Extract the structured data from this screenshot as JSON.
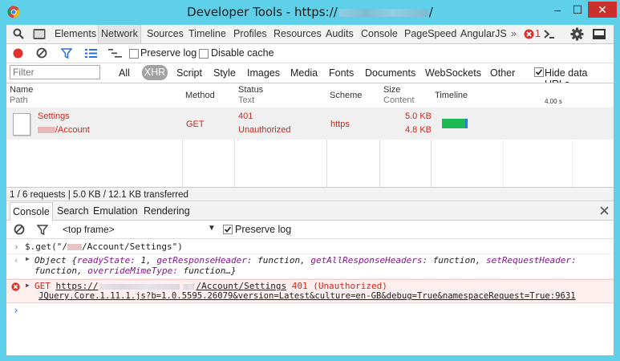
{
  "window": {
    "title_prefix": "Developer Tools - https://",
    "title_suffix": "/",
    "min": "–",
    "max": "☐",
    "close": "✕"
  },
  "panel_tabs": [
    "Elements",
    "Network",
    "Sources",
    "Timeline",
    "Profiles",
    "Resources",
    "Audits",
    "Console",
    "PageSpeed",
    "AngularJS"
  ],
  "panel_more": "»",
  "error_count": "1",
  "toolbar": {
    "preserve_log": "Preserve log",
    "disable_cache": "Disable cache"
  },
  "filter": {
    "placeholder": "Filter"
  },
  "types": [
    "All",
    "XHR",
    "Script",
    "Style",
    "Images",
    "Media",
    "Fonts",
    "Documents",
    "WebSockets",
    "Other"
  ],
  "hide_data_urls": "Hide data URLs",
  "columns": {
    "name": "Name",
    "path": "Path",
    "method": "Method",
    "status": "Status",
    "text": "Text",
    "scheme": "Scheme",
    "size": "Size",
    "content": "Content",
    "timeline": "Timeline",
    "tick": "4.00 s"
  },
  "request": {
    "name": "Settings",
    "path": "/Account",
    "method": "GET",
    "status": "401",
    "status_text": "Unauthorized",
    "scheme": "https",
    "size": "5.0 KB",
    "content": "4.8 KB"
  },
  "status_bar": "1 / 6 requests  |  5.0 KB / 12.1 KB transferred",
  "drawer_tabs": [
    "Console",
    "Search",
    "Emulation",
    "Rendering"
  ],
  "console_toolbar": {
    "frame": "<top frame>",
    "preserve_log": "Preserve log"
  },
  "console": {
    "cmd_a": "$.get(\"/",
    "cmd_b": "/Account/Settings\")",
    "obj_prefix": "Object {",
    "obj_k1": "readyState:",
    "obj_v1": " 1,",
    "obj_k2": "getResponseHeader:",
    "obj_v2": " function,",
    "obj_k3": "getAllResponseHeaders:",
    "obj_v3": " function,",
    "obj_k4": "setRequestHeader:",
    "obj_v4": " function,",
    "obj_k5": "overrideMimeType:",
    "obj_v5": " function…}",
    "err_get": "GET",
    "err_url_a": "https://",
    "err_url_b": "/Account/Settings",
    "err_status": "401 (Unauthorized)",
    "err_source": "JQuery.Core.1.11.1.js?b=1.0.5595.26079&version=Latest&culture=en-GB&debug=True&namespaceRequest=True:9631",
    "prompt": "›"
  },
  "colors": {
    "window": "#5fd0ea",
    "error": "#d0271c",
    "close": "#c9302c",
    "timeline_bar": "#1db954",
    "timeline_recv": "#2b7bd4"
  }
}
